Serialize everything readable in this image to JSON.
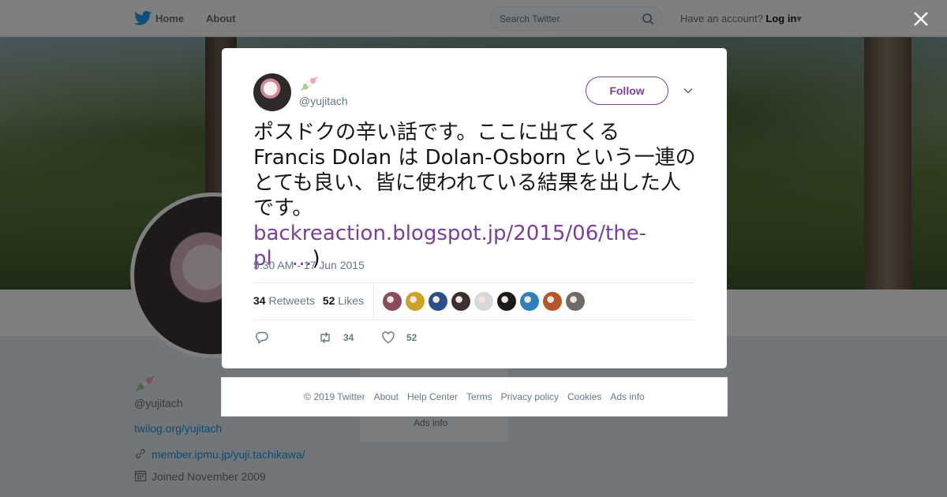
{
  "nav": {
    "home_label": "Home",
    "about_label": "About",
    "search_placeholder": "Search Twitter",
    "have_account": "Have an account?",
    "login_label": "Log in"
  },
  "profile": {
    "handle": "@yujitach",
    "website": "twilog.org/yujitach",
    "link": "member.ipmu.jp/yuji.tachikawa/",
    "joined": "Joined November 2009",
    "gray_ads_info": "Ads info"
  },
  "tweet": {
    "handle": "@yujitach",
    "follow_label": "Follow",
    "text": "ポスドクの辛い話です。ここに出てくる Francis Dolan は Dolan-Osborn という一連のとても良い、皆に使われている結果を出した人です。",
    "link": "backreaction.blogspot.jp/2015/06/the-pl",
    "ellipsis": "…",
    "close_paren": ")",
    "timestamp": "5:30 AM - 17 Jun 2015",
    "retweets_count": "34",
    "retweets_label": "Retweets",
    "likes_count": "52",
    "likes_label": "Likes",
    "action_retweet_count": "34",
    "action_like_count": "52"
  },
  "likers": [
    {
      "name": "liker-avatar-1",
      "color": "#8a4b5a"
    },
    {
      "name": "liker-avatar-2",
      "color": "#c9a227"
    },
    {
      "name": "liker-avatar-3",
      "color": "#2b4f8a"
    },
    {
      "name": "liker-avatar-4",
      "color": "#3b2f2f"
    },
    {
      "name": "liker-avatar-5",
      "color": "#d8d8d8"
    },
    {
      "name": "liker-avatar-6",
      "color": "#1a1a1a"
    },
    {
      "name": "liker-avatar-7",
      "color": "#2f7fb8"
    },
    {
      "name": "liker-avatar-8",
      "color": "#b5552a"
    },
    {
      "name": "liker-avatar-9",
      "color": "#6e6a66"
    }
  ],
  "footer": {
    "copyright": "© 2019 Twitter",
    "about": "About",
    "help": "Help Center",
    "terms": "Terms",
    "privacy": "Privacy policy",
    "cookies": "Cookies",
    "ads": "Ads info"
  },
  "colors": {
    "accent": "#7b3f9a",
    "twitter_blue": "#1da1f2"
  }
}
